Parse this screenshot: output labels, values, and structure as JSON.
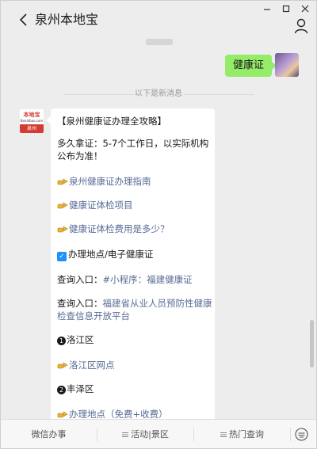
{
  "header": {
    "title": "泉州本地宝"
  },
  "chat": {
    "outgoing": {
      "text": "健康证"
    },
    "divider": "以下是新消息",
    "bot_avatar": {
      "top": "本地宝",
      "mid": "Bendibao.com",
      "bar": "泉州"
    },
    "message": {
      "title": "【泉州健康证办理全攻略】",
      "duration": "多久拿证：5-7个工作日，以实际机构公布为准！",
      "link_guide": "泉州健康证办理指南",
      "link_items": "健康证体检项目",
      "link_fee": "健康证体检费用是多少？",
      "section_location": "办理地点/电子健康证",
      "query1_label": "查询入口：",
      "query1_link": "#小程序：福建健康证",
      "query2_label": "查询入口：",
      "query2_link": "福建省从业人员预防性健康检查信息开放平台",
      "district1": "洛江区",
      "district1_link": "洛江区网点",
      "district2": "丰泽区",
      "district2_link": "办理地点（免费+收费）"
    }
  },
  "menu": {
    "items": [
      "微信办事",
      "活动|景区",
      "热门查询"
    ]
  },
  "colors": {
    "accent_link": "#576b95",
    "bubble_out": "#95ec69",
    "bot_red": "#d43c33"
  }
}
